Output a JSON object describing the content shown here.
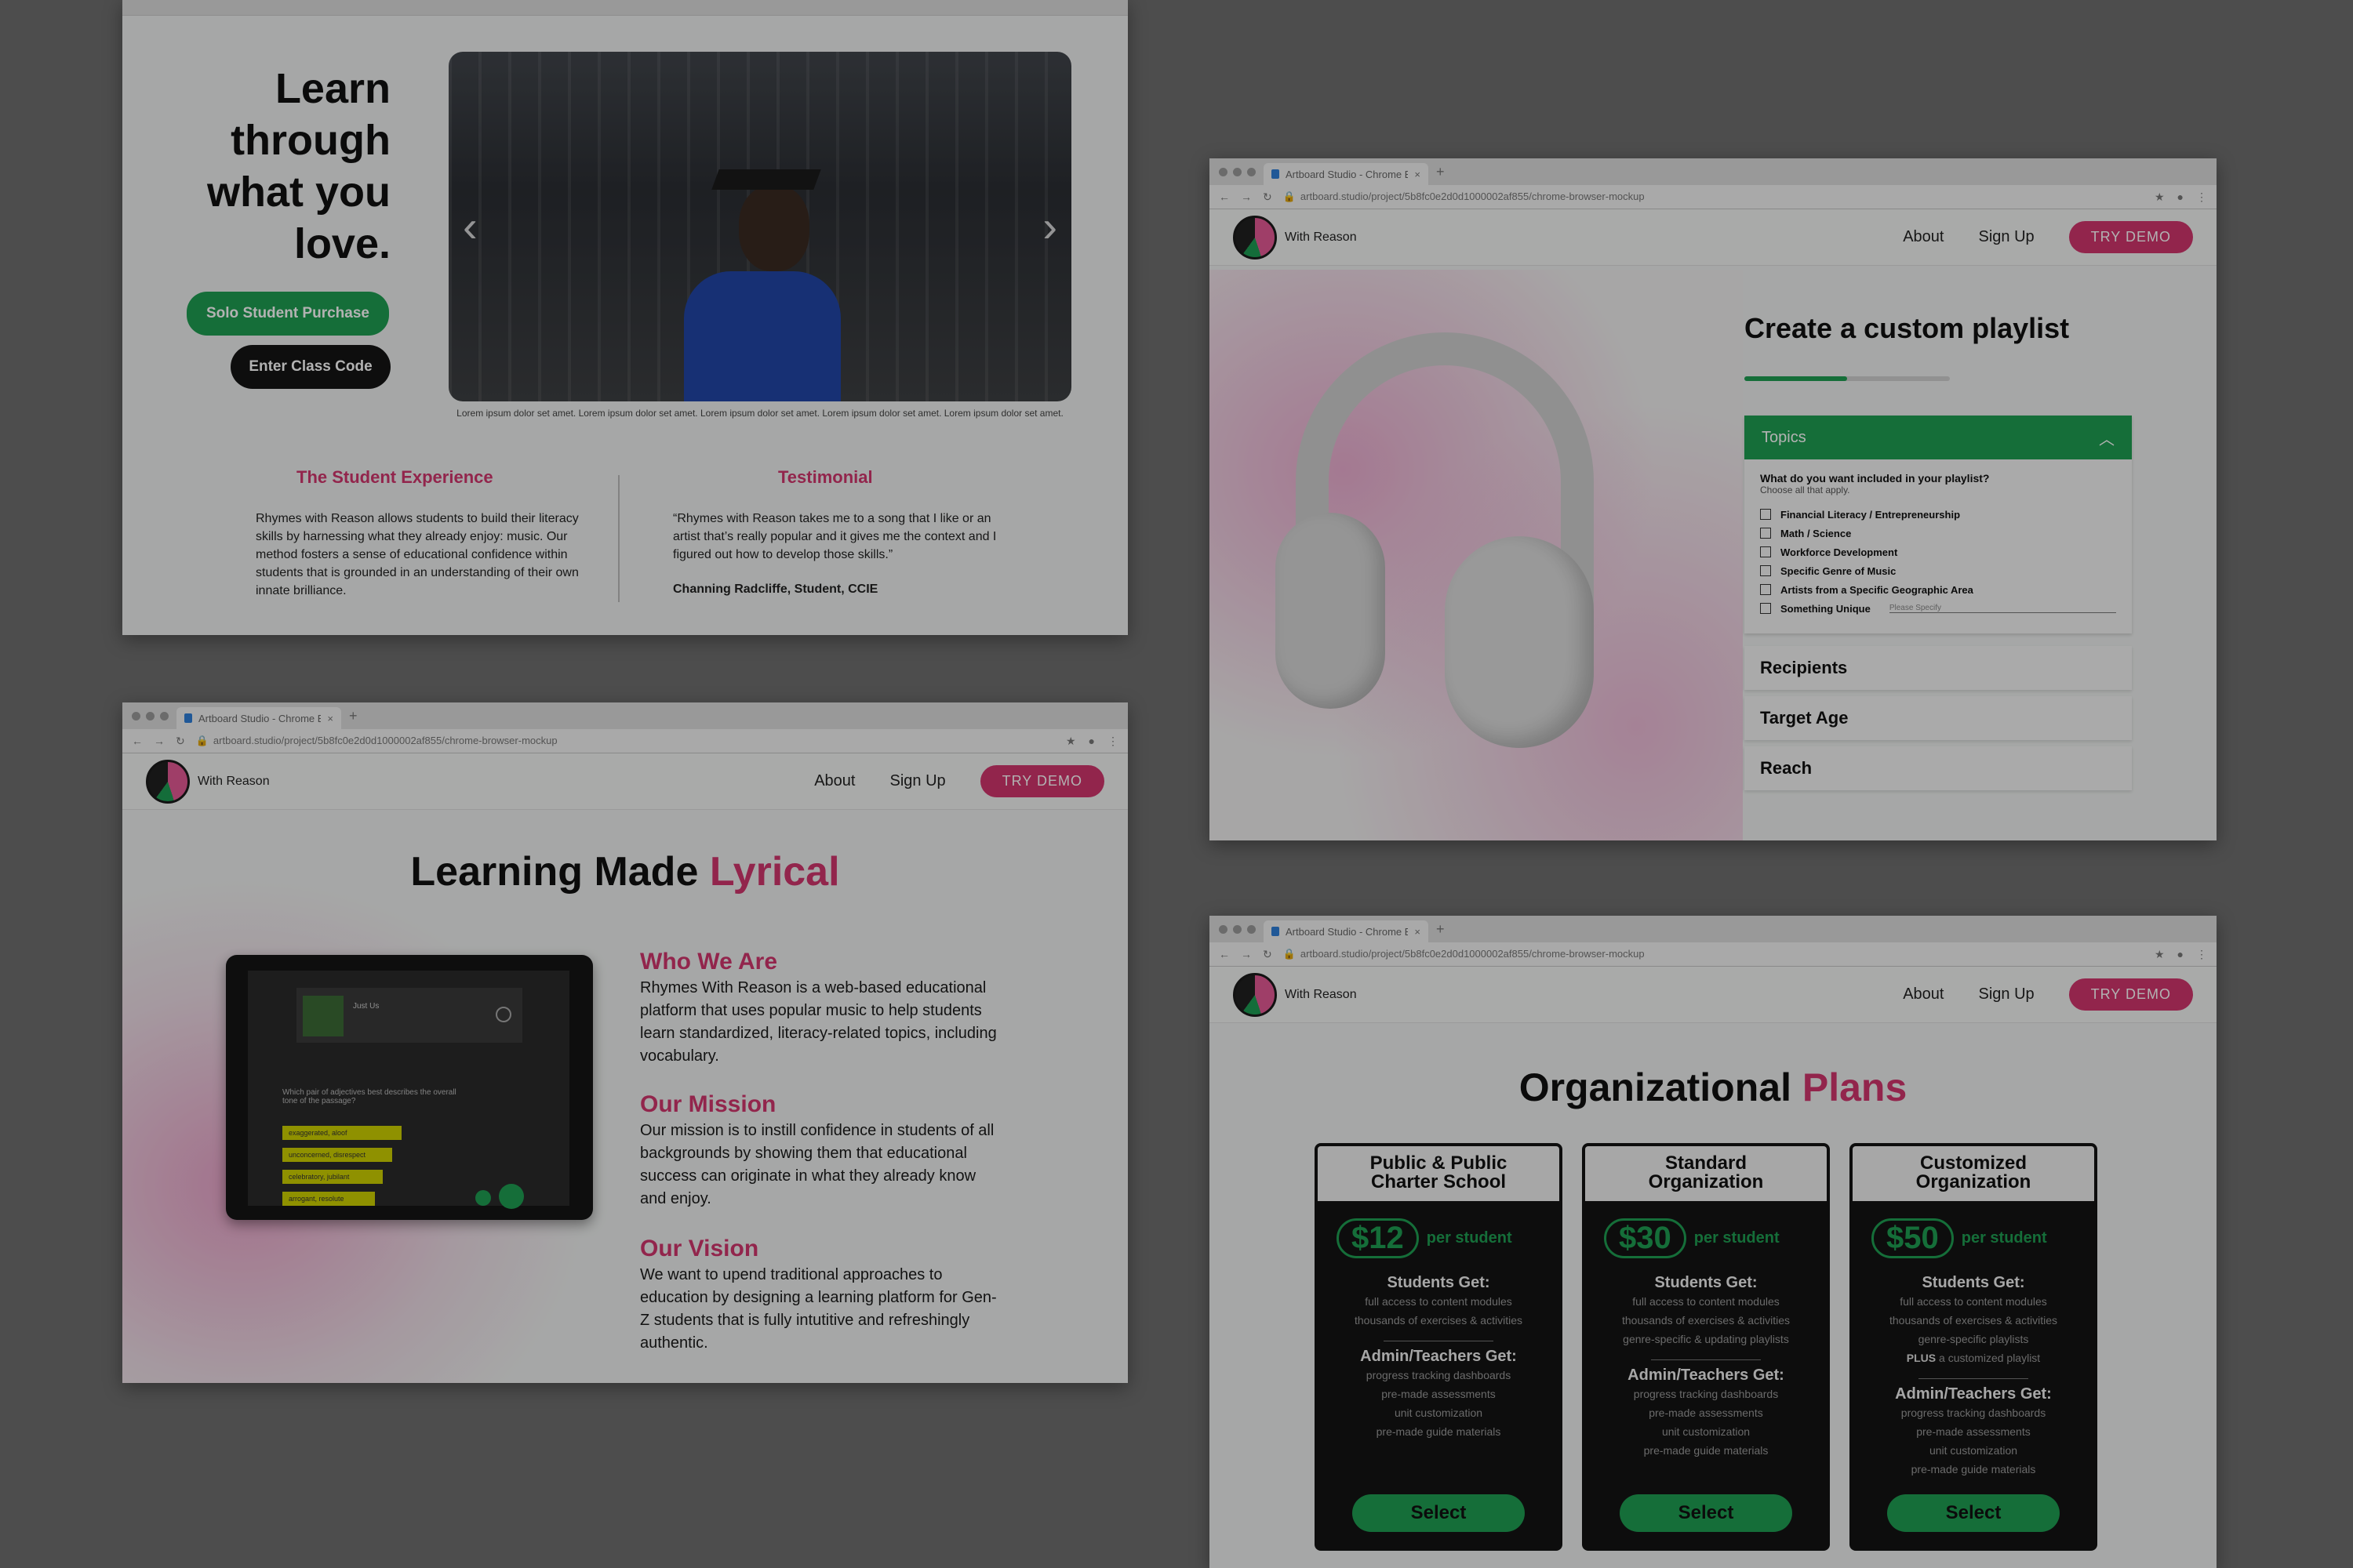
{
  "chrome": {
    "tab_title": "Artboard Studio - Chrome Brows...",
    "tab_close": "×",
    "new_tab": "+",
    "url": "artboard.studio/project/5b8fc0e2d0d1000002af855/chrome-browser-mockup"
  },
  "site": {
    "brand": "With Reason",
    "nav": {
      "about": "About",
      "signup": "Sign Up",
      "demo": "TRY DEMO"
    }
  },
  "student_page": {
    "headline": [
      "Learn",
      "through",
      "what you",
      "love."
    ],
    "solo_button": "Solo Student Purchase",
    "class_button": "Enter Class Code",
    "caption": "Lorem ipsum dolor set amet. Lorem ipsum dolor set amet. Lorem ipsum dolor set amet. Lorem ipsum dolor set amet. Lorem ipsum dolor set amet.",
    "experience_title": "The Student Experience",
    "experience_text": "Rhymes with Reason allows students to build their literacy skills by harnessing what they already enjoy: music. Our method fosters a sense of educational confidence within students that is grounded in an understanding of their own innate brilliance.",
    "testimonial_title": "Testimonial",
    "testimonial_text": "“Rhymes with Reason takes me to a song that I like or an artist that’s really popular and it gives me the context and I figured out how to develop those skills.”",
    "testimonial_author": "Channing Radcliffe, Student, CCIE"
  },
  "about_page": {
    "title_a": "Learning Made ",
    "title_b": "Lyrical",
    "tablet": {
      "song": "Just Us",
      "question": "Which pair of adjectives best describes the overall tone of the passage?",
      "options": [
        "exaggerated, aloof",
        "unconcerned, disrespect",
        "celebratory, jubilant",
        "arrogant, resolute"
      ]
    },
    "who_title": "Who We Are",
    "who_text": "Rhymes With Reason is a web-based educational platform that uses popular music to help students learn standardized, literacy-related topics, including vocabulary.",
    "mission_title": "Our Mission",
    "mission_text": "Our mission is to instill confidence in students of all backgrounds by showing them that educational success can originate in what they already know and enjoy.",
    "vision_title": "Our Vision",
    "vision_text": "We want to upend traditional approaches to education by designing a learning platform for Gen-Z students that is fully intutitive and refreshingly authentic."
  },
  "playlist_page": {
    "title": "Create a custom playlist",
    "progress": 0.5,
    "topics_label": "Topics",
    "question": "What do you want included in your playlist?",
    "subtext": "Choose all that apply.",
    "options": [
      "Financial Literacy / Entrepreneurship",
      "Math / Science",
      "Workforce Development",
      "Specific Genre of Music",
      "Artists from a Specific Geographic Area",
      "Something Unique"
    ],
    "specify_placeholder": "Please Specify",
    "sections": [
      "Recipients",
      "Target Age",
      "Reach"
    ]
  },
  "plans_page": {
    "title_a": "Organizational ",
    "title_b": "Plans",
    "per_student": "per student",
    "select": "Select",
    "plans": [
      {
        "name_1": "Public & Public",
        "name_2": "Charter School",
        "price": "$12",
        "students_title": "Students Get:",
        "students": [
          "full access to content modules",
          "thousands of exercises & activities"
        ],
        "admin_title": "Admin/Teachers Get:",
        "admin": [
          "progress tracking dashboards",
          "pre-made assessments",
          "unit customization",
          "pre-made guide materials"
        ]
      },
      {
        "name_1": "Standard",
        "name_2": "Organization",
        "price": "$30",
        "students_title": "Students Get:",
        "students": [
          "full access to content modules",
          "thousands of exercises & activities",
          "genre-specific & updating playlists"
        ],
        "admin_title": "Admin/Teachers Get:",
        "admin": [
          "progress tracking dashboards",
          "pre-made assessments",
          "unit customization",
          "pre-made guide materials"
        ]
      },
      {
        "name_1": "Customized",
        "name_2": "Organization",
        "price": "$50",
        "students_title": "Students Get:",
        "students": [
          "full access to content modules",
          "thousands of exercises & activities",
          "genre-specific playlists"
        ],
        "plus_bold": "PLUS",
        "plus_rest": " a customized playlist",
        "admin_title": "Admin/Teachers Get:",
        "admin": [
          "progress tracking dashboards",
          "pre-made assessments",
          "unit customization",
          "pre-made guide materials"
        ]
      }
    ]
  },
  "colors": {
    "pink": "#d2356d",
    "green": "#1f9e52",
    "dark": "#151515"
  }
}
